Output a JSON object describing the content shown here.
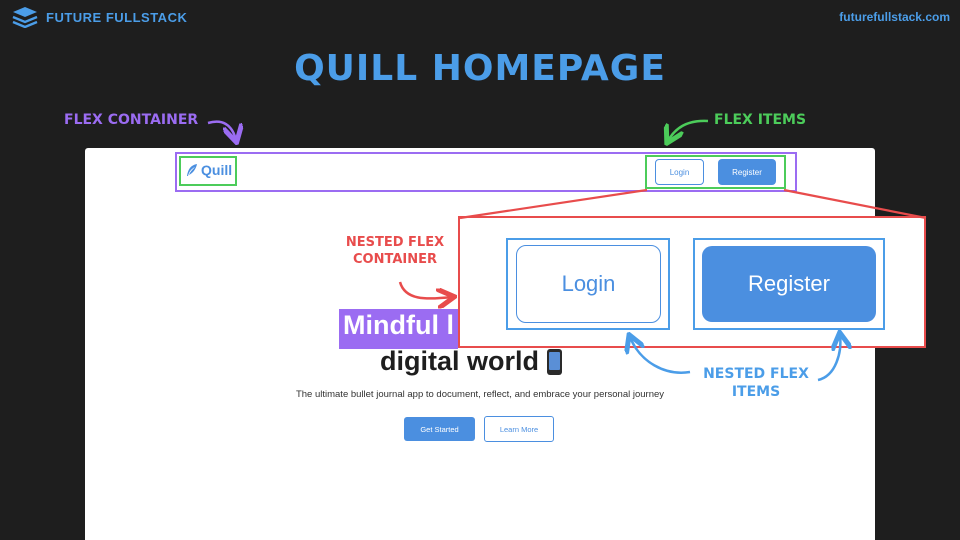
{
  "header": {
    "brand_name": "FUTURE FULLSTACK",
    "site_url": "futurefullstack.com",
    "brand_icon": "stacked-layers-icon"
  },
  "slide_title": "QUILL HOMEPAGE",
  "annotations": {
    "flex_container": "FLEX CONTAINER",
    "flex_items": "FLEX ITEMS",
    "nested_flex_container_line1": "NESTED FLEX",
    "nested_flex_container_line2": "CONTAINER",
    "nested_flex_items_line1": "NESTED FLEX",
    "nested_flex_items_line2": "ITEMS"
  },
  "quill_app": {
    "nav": {
      "logo_text": "Quill",
      "logo_icon": "feather-icon",
      "login_label": "Login",
      "register_label": "Register"
    },
    "hero": {
      "title_line1": "Mindful l",
      "title_line2": "digital world",
      "title_icon": "mobile-phone-icon",
      "subtitle": "The ultimate bullet journal app to document, reflect, and embrace your personal journey",
      "get_started_label": "Get Started",
      "learn_more_label": "Learn More"
    }
  },
  "zoom": {
    "login_label": "Login",
    "register_label": "Register"
  },
  "colors": {
    "background": "#1e1e1e",
    "blue": "#4b9de8",
    "purple": "#9b6cf2",
    "green": "#4ccc5a",
    "red": "#e84c4c"
  }
}
